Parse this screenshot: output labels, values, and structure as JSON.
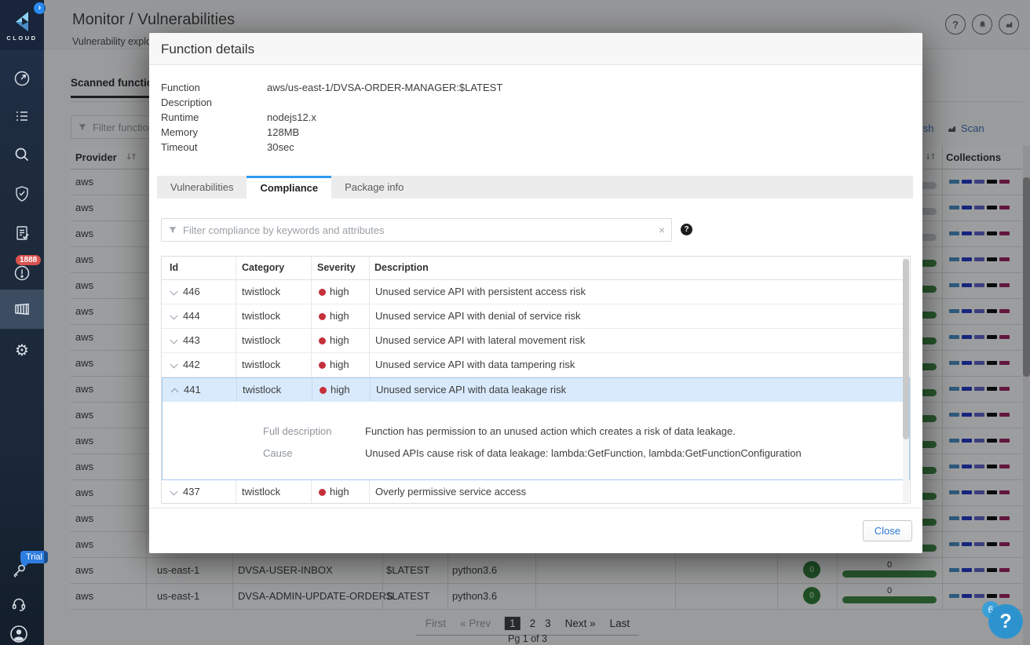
{
  "colors": {
    "accent_blue": "#2e7fd0",
    "tab_active_blue": "#2f9bf0",
    "severity_high_red": "#c5303c",
    "success_green": "#3e8a43",
    "alerts_badge_red": "#d9534f",
    "trial_blue": "#2e7de1",
    "help_fab_blue": "#2d93cf",
    "row_highlight_blue": "#d9eafc",
    "collections_palette": [
      "#4a8fc7",
      "#2038c8",
      "#5e61c9",
      "#0c0c0c",
      "#9e2160"
    ]
  },
  "sidebar": {
    "logo_text": "CLOUD",
    "collapse_chevron": "›",
    "items": [
      {
        "icon": "gauge-icon"
      },
      {
        "icon": "checklist-icon"
      },
      {
        "icon": "search-icon"
      },
      {
        "icon": "shield-check-icon"
      },
      {
        "icon": "document-check-icon"
      },
      {
        "icon": "alert-circle-icon",
        "badge": "1888"
      },
      {
        "icon": "container-icon",
        "active": true
      },
      {
        "icon": "gear-icon"
      }
    ],
    "bottom_items": [
      {
        "icon": "key-icon",
        "badge": "Trial"
      },
      {
        "icon": "headset-icon"
      },
      {
        "icon": "user-icon"
      }
    ]
  },
  "header": {
    "title": "Monitor / Vulnerabilities",
    "subtitle": "Vulnerability explorer",
    "top_icons": [
      "help-icon",
      "bell-icon",
      "chart-icon"
    ]
  },
  "toolbar": {
    "tab_label": "Scanned functions",
    "filter_placeholder": "Filter functions by keywords and attributes",
    "refresh_label": "Refresh",
    "scan_label": "Scan"
  },
  "functions_table": {
    "provider_header": "Provider",
    "collections_header": "Collections",
    "covered_rows": [
      {
        "provider": "aws",
        "bar_style": "gray"
      },
      {
        "provider": "aws",
        "bar_style": "gray"
      },
      {
        "provider": "aws",
        "bar_style": "gray"
      },
      {
        "provider": "aws",
        "bar_style": "green"
      },
      {
        "provider": "aws",
        "bar_style": "green"
      },
      {
        "provider": "aws",
        "bar_style": "green"
      },
      {
        "provider": "aws",
        "bar_style": "green"
      },
      {
        "provider": "aws",
        "bar_style": "green"
      },
      {
        "provider": "aws",
        "bar_style": "green"
      },
      {
        "provider": "aws",
        "bar_style": "green"
      },
      {
        "provider": "aws",
        "bar_style": "green"
      },
      {
        "provider": "aws",
        "bar_style": "green"
      },
      {
        "provider": "aws",
        "bar_style": "green"
      },
      {
        "provider": "aws",
        "bar_style": "green"
      },
      {
        "provider": "aws",
        "bar_style": "green"
      }
    ],
    "visible_rows": [
      {
        "provider": "aws",
        "region": "us-east-1",
        "function": "DVSA-USER-INBOX",
        "version": "$LATEST",
        "runtime": "python3.6",
        "runtime_vulns": "0",
        "compliance_count": "0"
      },
      {
        "provider": "aws",
        "region": "us-east-1",
        "function": "DVSA-ADMIN-UPDATE-ORDERS",
        "version": "$LATEST",
        "runtime": "python3.6",
        "runtime_vulns": "0",
        "compliance_count": "0"
      }
    ]
  },
  "pagination": {
    "first_label": "First",
    "prev_label": "« Prev",
    "pages": [
      "1",
      "2",
      "3"
    ],
    "active_page": "1",
    "next_label": "Next »",
    "last_label": "Last",
    "status": "Pg 1 of 3"
  },
  "modal": {
    "title": "Function details",
    "details": [
      {
        "label": "Function",
        "value": "aws/us-east-1/DVSA-ORDER-MANAGER:$LATEST"
      },
      {
        "label": "Description",
        "value": ""
      },
      {
        "label": "Runtime",
        "value": "nodejs12.x"
      },
      {
        "label": "Memory",
        "value": "128MB"
      },
      {
        "label": "Timeout",
        "value": "30sec"
      }
    ],
    "tabs": [
      {
        "label": "Vulnerabilities",
        "active": false
      },
      {
        "label": "Compliance",
        "active": true
      },
      {
        "label": "Package info",
        "active": false
      }
    ],
    "filter_placeholder": "Filter compliance by keywords and attributes",
    "filter_clear": "×",
    "filter_help": "?",
    "compliance_table": {
      "columns": [
        "Id",
        "Category",
        "Severity",
        "Description"
      ],
      "rows": [
        {
          "id": "446",
          "category": "twistlock",
          "severity": "high",
          "description": "Unused service API with persistent access risk",
          "expanded": false
        },
        {
          "id": "444",
          "category": "twistlock",
          "severity": "high",
          "description": "Unused service API with denial of service risk",
          "expanded": false
        },
        {
          "id": "443",
          "category": "twistlock",
          "severity": "high",
          "description": "Unused service API with lateral movement risk",
          "expanded": false
        },
        {
          "id": "442",
          "category": "twistlock",
          "severity": "high",
          "description": "Unused service API with data tampering risk",
          "expanded": false
        },
        {
          "id": "441",
          "category": "twistlock",
          "severity": "high",
          "description": "Unused service API with data leakage risk",
          "expanded": true,
          "full_description_label": "Full description",
          "full_description": "Function has permission to an unused action which creates a risk of data leakage.",
          "cause_label": "Cause",
          "cause": "Unused APIs cause risk of data leakage: lambda:GetFunction, lambda:GetFunctionConfiguration"
        },
        {
          "id": "437",
          "category": "twistlock",
          "severity": "high",
          "description": "Overly permissive service access",
          "expanded": false
        }
      ]
    },
    "close_label": "Close"
  },
  "help_fab": {
    "label": "?",
    "badge": "6"
  }
}
